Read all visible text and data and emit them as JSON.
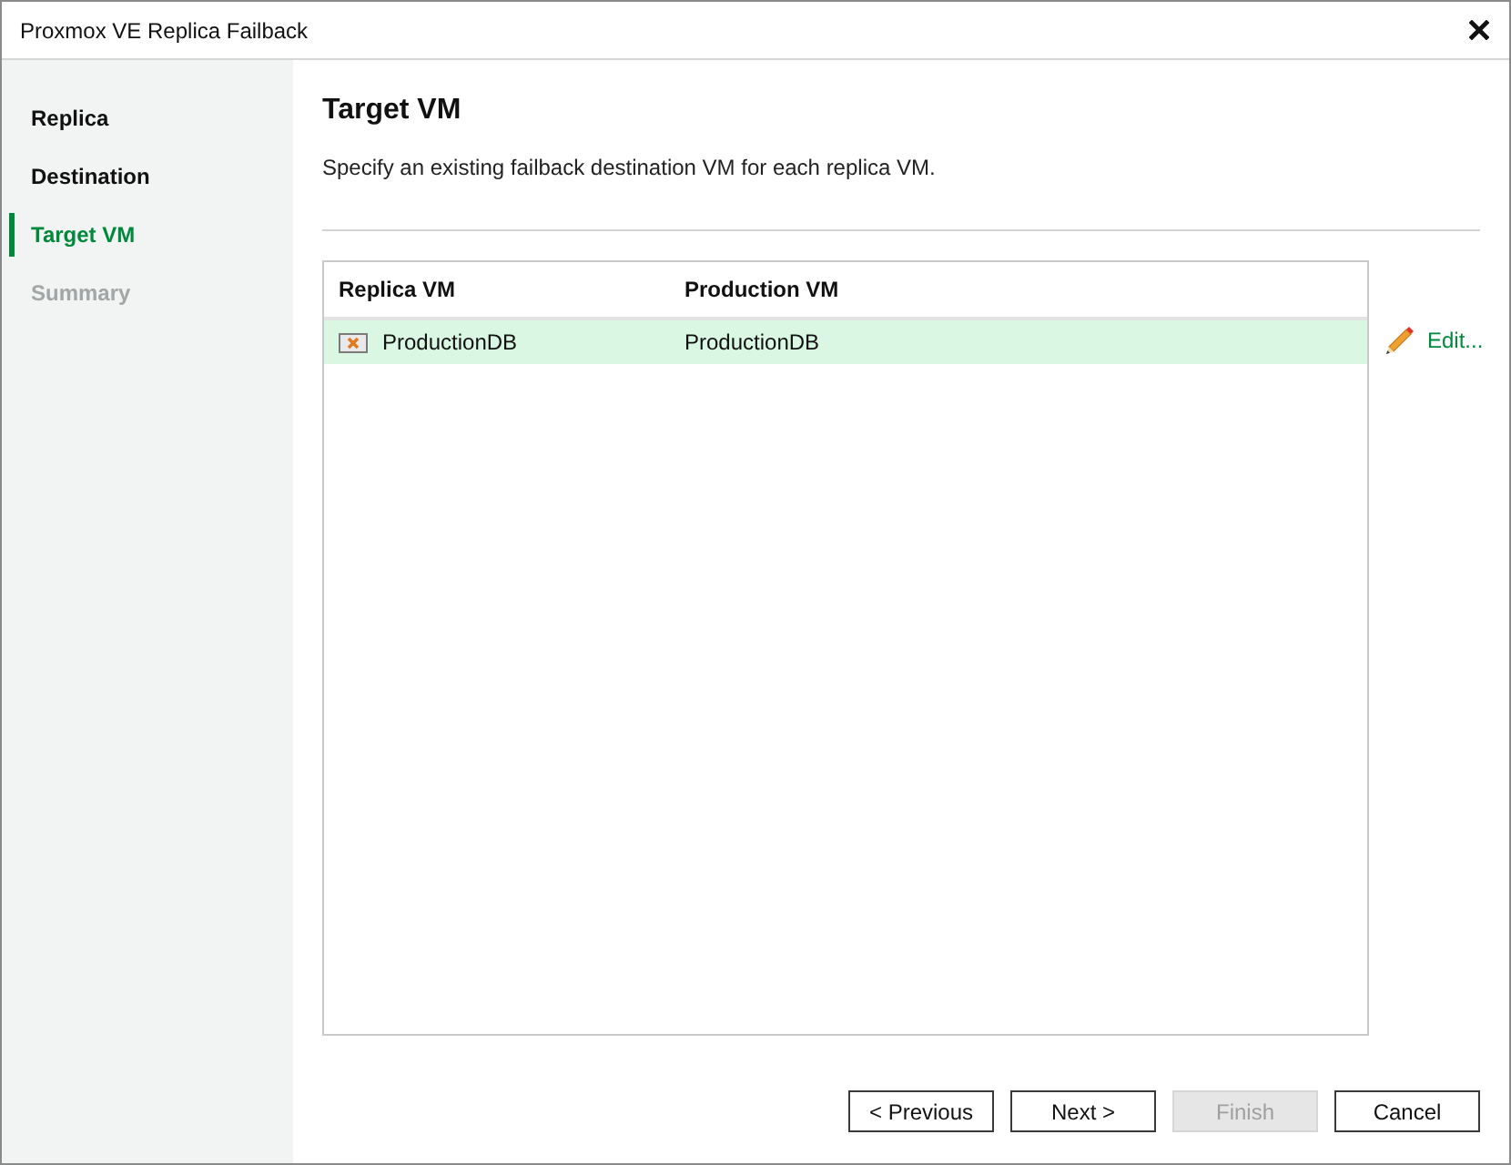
{
  "window": {
    "title": "Proxmox VE Replica Failback"
  },
  "steps": [
    {
      "label": "Replica",
      "selected": false,
      "disabled": false
    },
    {
      "label": "Destination",
      "selected": false,
      "disabled": false
    },
    {
      "label": "Target VM",
      "selected": true,
      "disabled": false
    },
    {
      "label": "Summary",
      "selected": false,
      "disabled": true
    }
  ],
  "page": {
    "title": "Target VM",
    "description": "Specify an existing failback destination VM for each replica VM."
  },
  "table": {
    "columns": [
      "Replica VM",
      "Production VM"
    ],
    "rows": [
      {
        "replica_vm": "ProductionDB",
        "production_vm": "ProductionDB",
        "selected": true
      }
    ]
  },
  "edit_link": {
    "label": "Edit..."
  },
  "buttons": [
    {
      "label": "< Previous",
      "disabled": false
    },
    {
      "label": "Next >",
      "disabled": false
    },
    {
      "label": "Finish",
      "disabled": true
    },
    {
      "label": "Cancel",
      "disabled": false
    }
  ]
}
